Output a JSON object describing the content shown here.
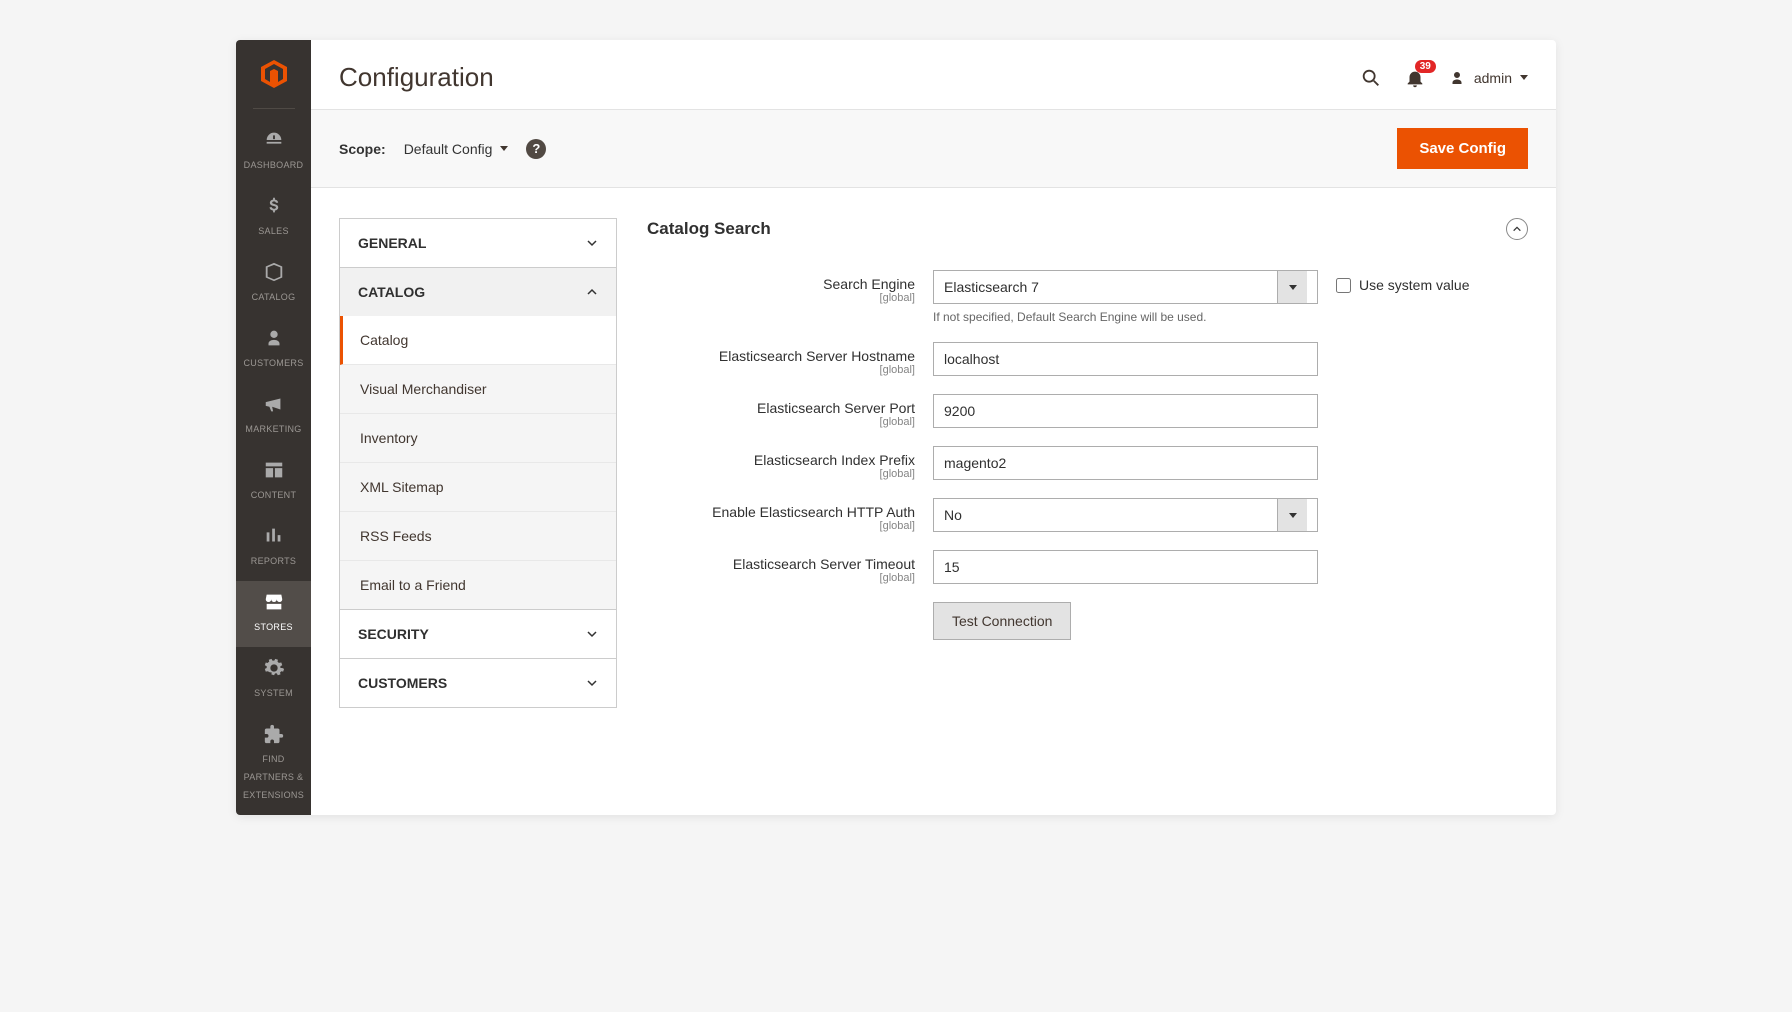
{
  "page": {
    "title": "Configuration"
  },
  "header": {
    "notification_count": "39",
    "user_name": "admin"
  },
  "scopebar": {
    "label": "Scope:",
    "value": "Default Config",
    "save_label": "Save Config"
  },
  "nav": {
    "items": [
      {
        "label": "DASHBOARD"
      },
      {
        "label": "SALES"
      },
      {
        "label": "CATALOG"
      },
      {
        "label": "CUSTOMERS"
      },
      {
        "label": "MARKETING"
      },
      {
        "label": "CONTENT"
      },
      {
        "label": "REPORTS"
      },
      {
        "label": "STORES"
      },
      {
        "label": "SYSTEM"
      },
      {
        "label": "FIND PARTNERS & EXTENSIONS"
      }
    ]
  },
  "tree": {
    "groups": [
      {
        "label": "GENERAL"
      },
      {
        "label": "CATALOG",
        "expanded": true,
        "items": [
          {
            "label": "Catalog"
          },
          {
            "label": "Visual Merchandiser"
          },
          {
            "label": "Inventory"
          },
          {
            "label": "XML Sitemap"
          },
          {
            "label": "RSS Feeds"
          },
          {
            "label": "Email to a Friend"
          }
        ]
      },
      {
        "label": "SECURITY"
      },
      {
        "label": "CUSTOMERS"
      }
    ]
  },
  "panel": {
    "title": "Catalog Search",
    "fields": {
      "search_engine": {
        "label": "Search Engine",
        "scope": "[global]",
        "value": "Elasticsearch 7",
        "hint": "If not specified, Default Search Engine will be used.",
        "use_system_label": "Use system value"
      },
      "hostname": {
        "label": "Elasticsearch Server Hostname",
        "scope": "[global]",
        "value": "localhost"
      },
      "port": {
        "label": "Elasticsearch Server Port",
        "scope": "[global]",
        "value": "9200"
      },
      "prefix": {
        "label": "Elasticsearch Index Prefix",
        "scope": "[global]",
        "value": "magento2"
      },
      "httpauth": {
        "label": "Enable Elasticsearch HTTP Auth",
        "scope": "[global]",
        "value": "No"
      },
      "timeout": {
        "label": "Elasticsearch Server Timeout",
        "scope": "[global]",
        "value": "15"
      },
      "test_btn": "Test Connection"
    }
  }
}
